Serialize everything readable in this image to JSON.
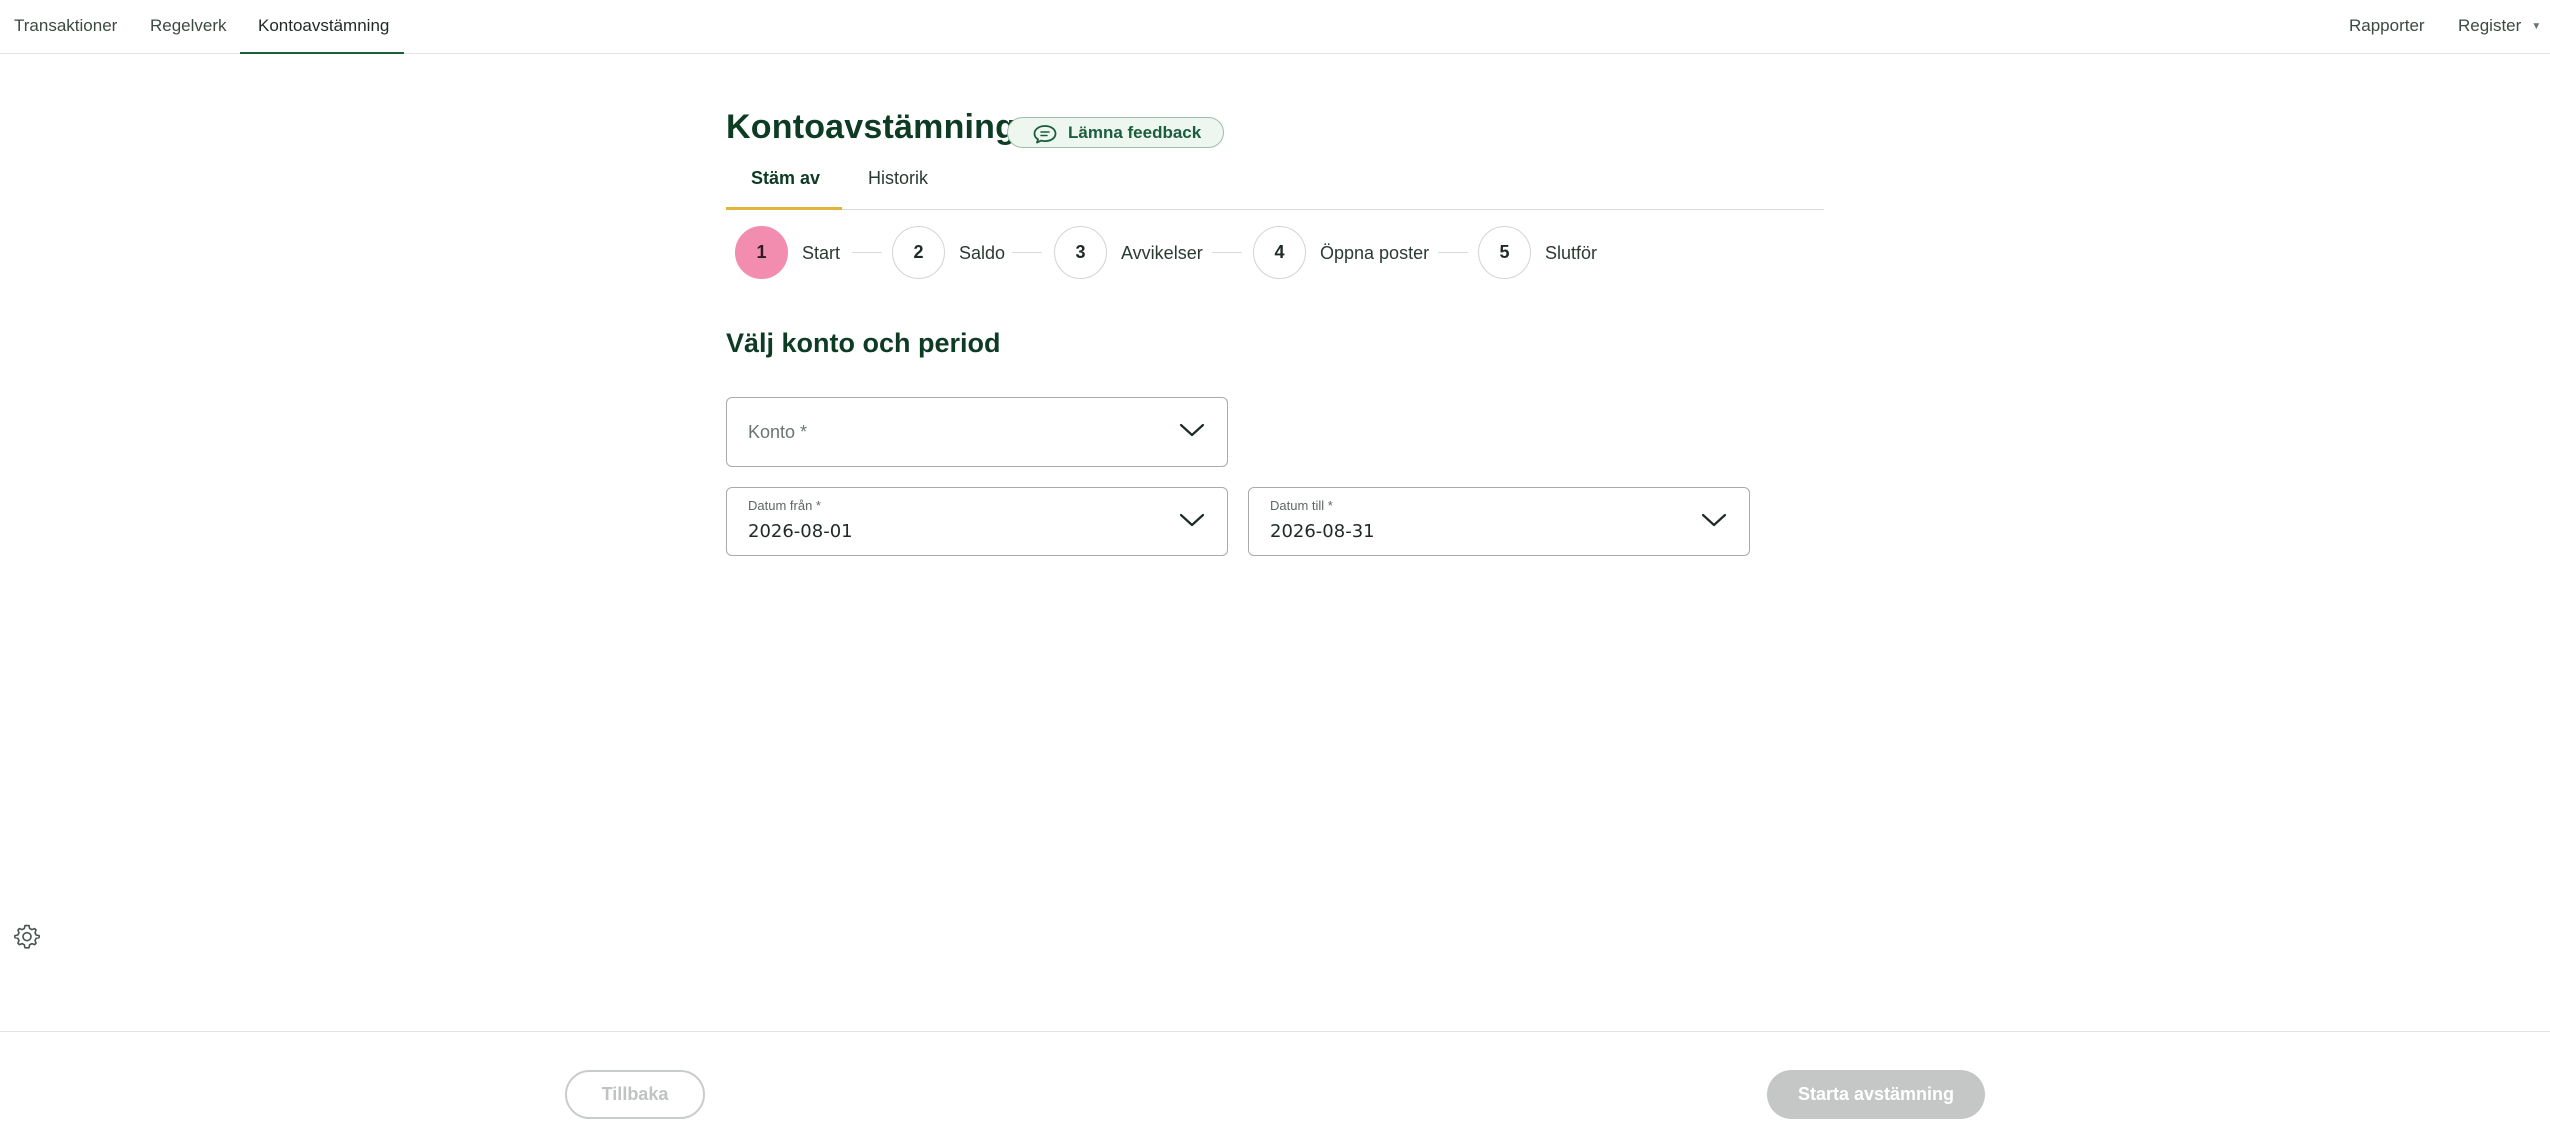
{
  "topnav": {
    "left_items": [
      {
        "label": "Transaktioner"
      },
      {
        "label": "Regelverk"
      },
      {
        "label": "Kontoavstämning",
        "active": true
      }
    ],
    "right_items": [
      {
        "label": "Rapporter"
      },
      {
        "label": "Register",
        "has_dropdown": true
      }
    ]
  },
  "header": {
    "title": "Kontoavstämning",
    "feedback_label": "Lämna feedback",
    "feedback_icon": "speech-bubble-icon"
  },
  "tabs": [
    {
      "label": "Stäm av",
      "active": true
    },
    {
      "label": "Historik"
    }
  ],
  "stepper": {
    "active_step": 1,
    "steps": [
      {
        "number": "1",
        "label": "Start"
      },
      {
        "number": "2",
        "label": "Saldo"
      },
      {
        "number": "3",
        "label": "Avvikelser"
      },
      {
        "number": "4",
        "label": "Öppna poster"
      },
      {
        "number": "5",
        "label": "Slutför"
      }
    ]
  },
  "form": {
    "section_title": "Välj konto och period",
    "account": {
      "placeholder": "Konto *"
    },
    "date_from": {
      "label": "Datum från *",
      "value": "2026-08-01"
    },
    "date_to": {
      "label": "Datum till *",
      "value": "2026-08-31"
    }
  },
  "footer": {
    "back_label": "Tillbaka",
    "start_label": "Starta avstämning"
  },
  "colors": {
    "brand_dark_green": "#0d3b24",
    "nav_active_underline": "#1b5e3b",
    "tab_active_underline": "#e2b43a",
    "active_step": "#f28db0",
    "feedback_bg": "#eef6f0",
    "disabled_button": "#c4c7c5"
  },
  "icons": {
    "settings": "gear-icon",
    "dropdown": "chevron-down-icon"
  }
}
